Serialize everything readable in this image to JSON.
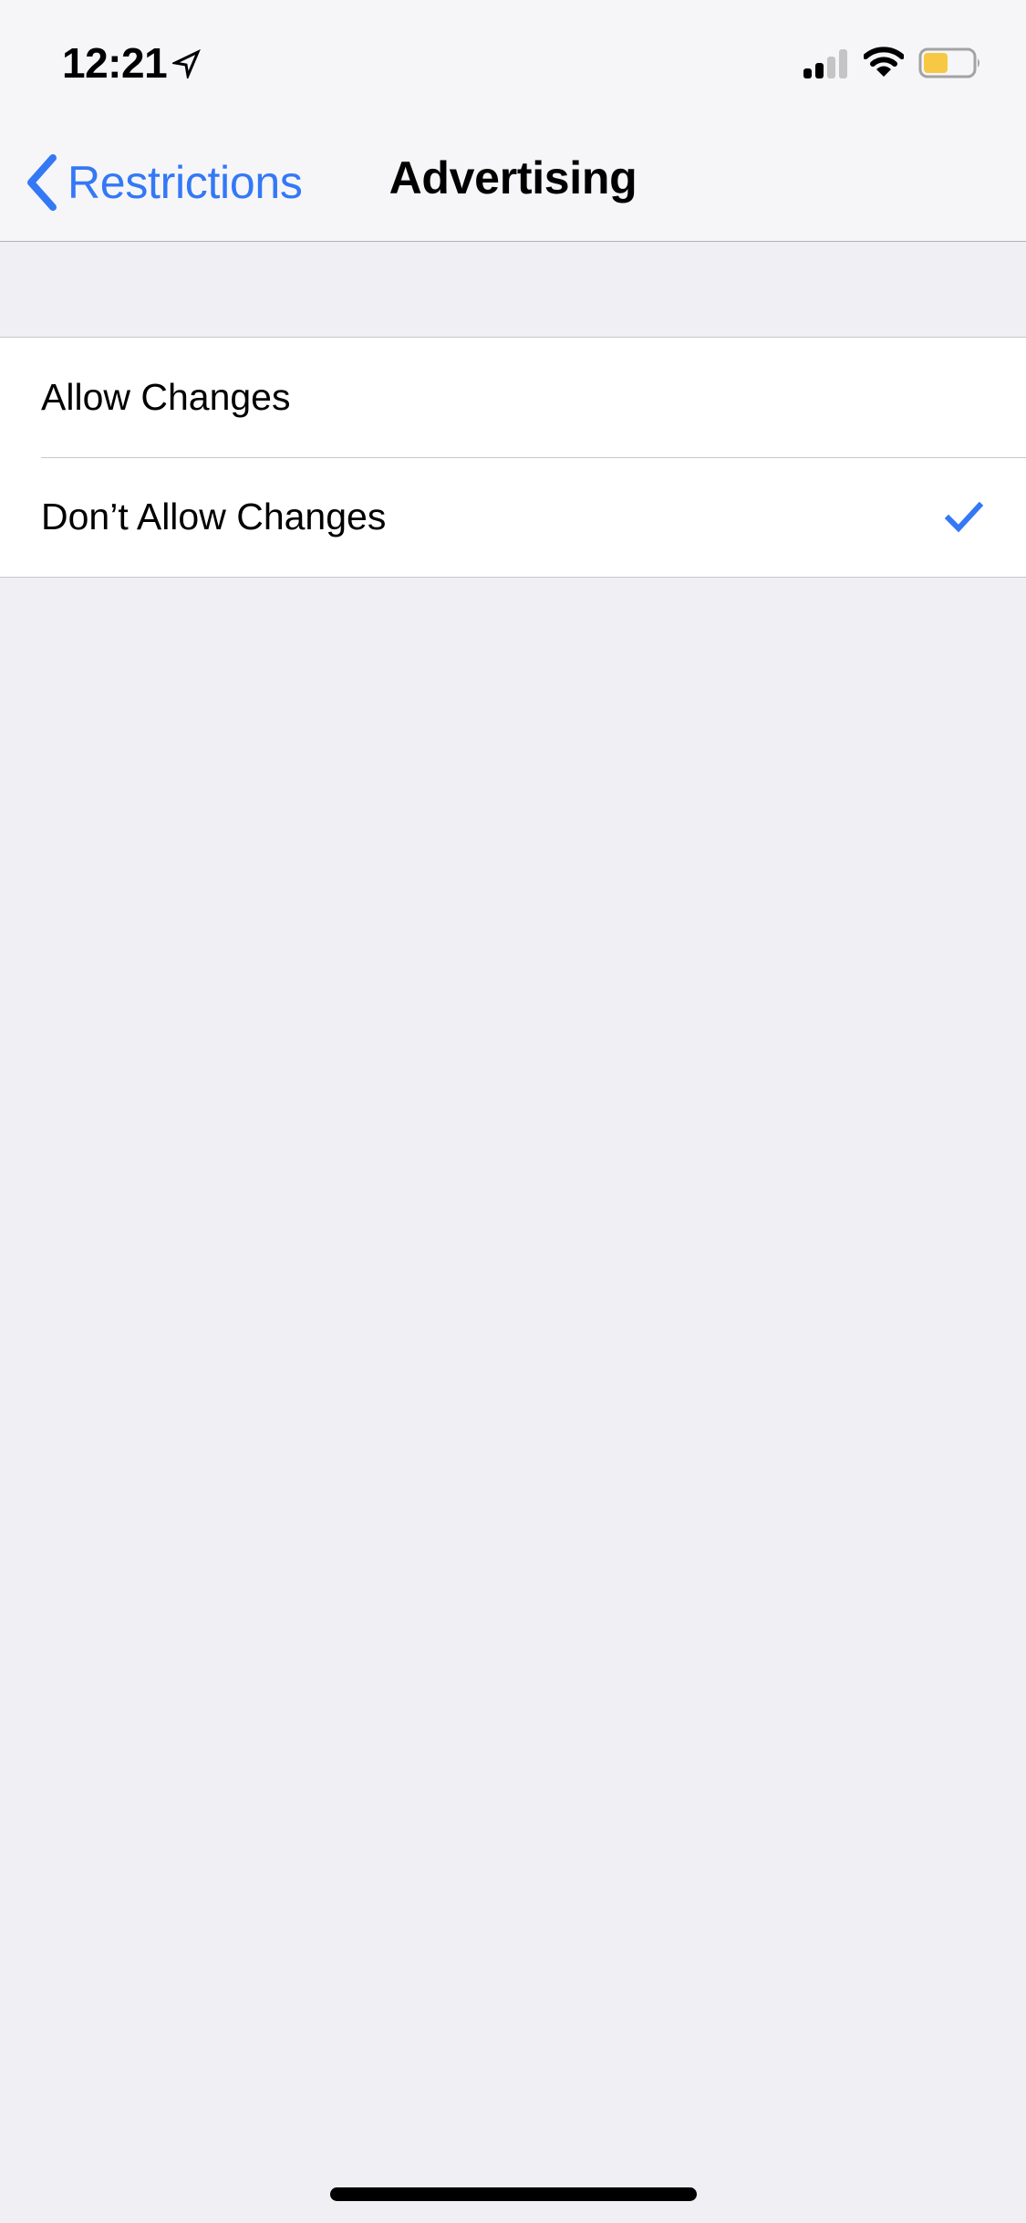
{
  "status_bar": {
    "time": "12:21",
    "location_icon": "location-arrow-icon",
    "signal_bars": 2,
    "signal_bars_total": 4,
    "wifi_icon": "wifi-icon",
    "battery_level": 0.5,
    "battery_color": "#f7c843",
    "low_power_mode": true
  },
  "nav": {
    "back_label": "Restrictions",
    "back_icon": "chevron-left-icon",
    "title": "Advertising",
    "accent_color": "#3478f6"
  },
  "options": [
    {
      "label": "Allow Changes",
      "selected": false
    },
    {
      "label": "Don’t Allow Changes",
      "selected": true
    }
  ],
  "selected_icon": "checkmark-icon"
}
